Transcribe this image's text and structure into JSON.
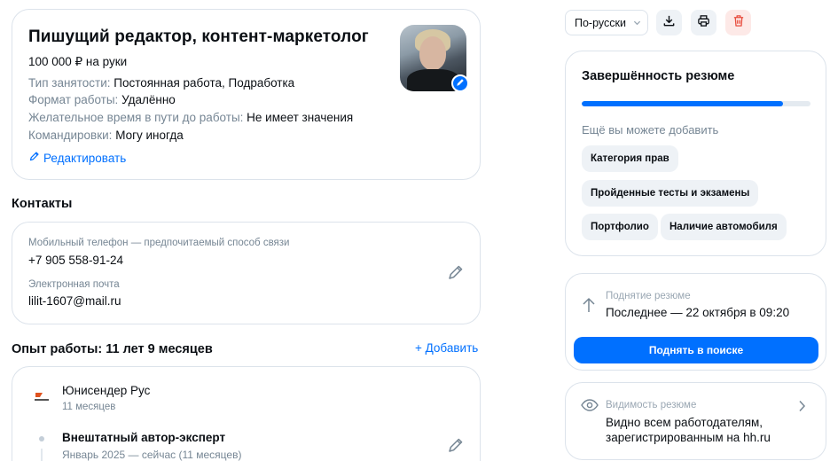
{
  "resume": {
    "title": "Пишущий редактор, контент-маркетолог",
    "salary": "100 000 ₽ на руки",
    "details": [
      {
        "key": "Тип занятости:",
        "value": "Постоянная работа, Подработка"
      },
      {
        "key": "Формат работы:",
        "value": "Удалённо"
      },
      {
        "key": "Желательное время в пути до работы:",
        "value": "Не имеет значения"
      },
      {
        "key": "Командировки:",
        "value": "Могу иногда"
      }
    ],
    "edit_label": "Редактировать"
  },
  "contacts": {
    "heading": "Контакты",
    "phone_label": "Мобильный телефон — предпочитаемый способ связи",
    "phone": "+7 905 558-91-24",
    "email_label": "Электронная почта",
    "email": "lilit-1607@mail.ru"
  },
  "experience": {
    "heading": "Опыт работы: 11 лет 9 месяцев",
    "add_label": "+ Добавить",
    "company": "Юнисендер Рус",
    "company_duration": "11 месяцев",
    "position": "Внештатный автор-эксперт",
    "dates": "Январь 2025 — сейчас (11 месяцев)"
  },
  "toolbar": {
    "language": "По-русски",
    "icons": [
      "download-icon",
      "print-icon",
      "trash-icon"
    ]
  },
  "completeness": {
    "title": "Завершённость резюме",
    "progress_fraction": 0.88,
    "subtitle": "Ещё вы можете добавить",
    "chips": [
      "Категория прав",
      "Пройденные тесты и экзамены",
      "Портфолио",
      "Наличие автомобиля"
    ]
  },
  "raise": {
    "label": "Поднятие резюме",
    "value": "Последнее — 22 октября в 09:20",
    "button": "Поднять в поиске"
  },
  "visibility": {
    "label": "Видимость резюме",
    "value": "Видно всем работодателям, зарегистрированным на hh.ru"
  },
  "colors": {
    "accent": "#0070ff",
    "muted": "#768694",
    "danger": "#e84c3d"
  }
}
